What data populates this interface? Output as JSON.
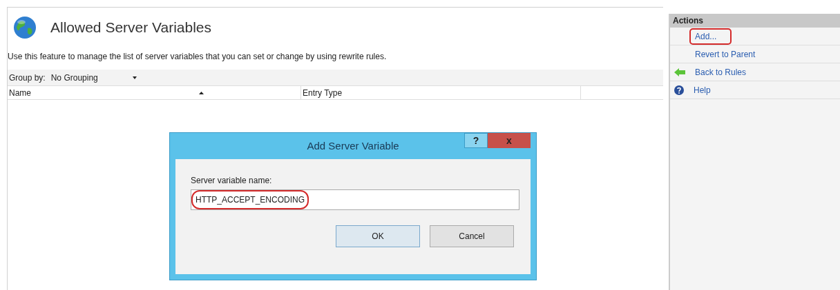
{
  "page": {
    "title": "Allowed Server Variables",
    "description": "Use this feature to manage the list of server variables that you can set or change by using rewrite rules.",
    "group_by": {
      "label": "Group by:",
      "value": "No Grouping"
    },
    "columns": [
      "Name",
      "Entry Type"
    ]
  },
  "actions": {
    "title": "Actions",
    "items": [
      {
        "label": "Add...",
        "kind": "plain",
        "highlighted": true
      },
      {
        "label": "Revert to Parent",
        "kind": "plain",
        "highlighted": false
      },
      {
        "label": "Back to Rules",
        "kind": "back",
        "highlighted": false
      },
      {
        "label": "Help",
        "kind": "help",
        "highlighted": false
      }
    ]
  },
  "dialog": {
    "title": "Add Server Variable",
    "help": "?",
    "close": "x",
    "field_label": "Server variable name:",
    "field_value": "HTTP_ACCEPT_ENCODING",
    "field_highlighted": true,
    "buttons": [
      "OK",
      "Cancel"
    ]
  }
}
